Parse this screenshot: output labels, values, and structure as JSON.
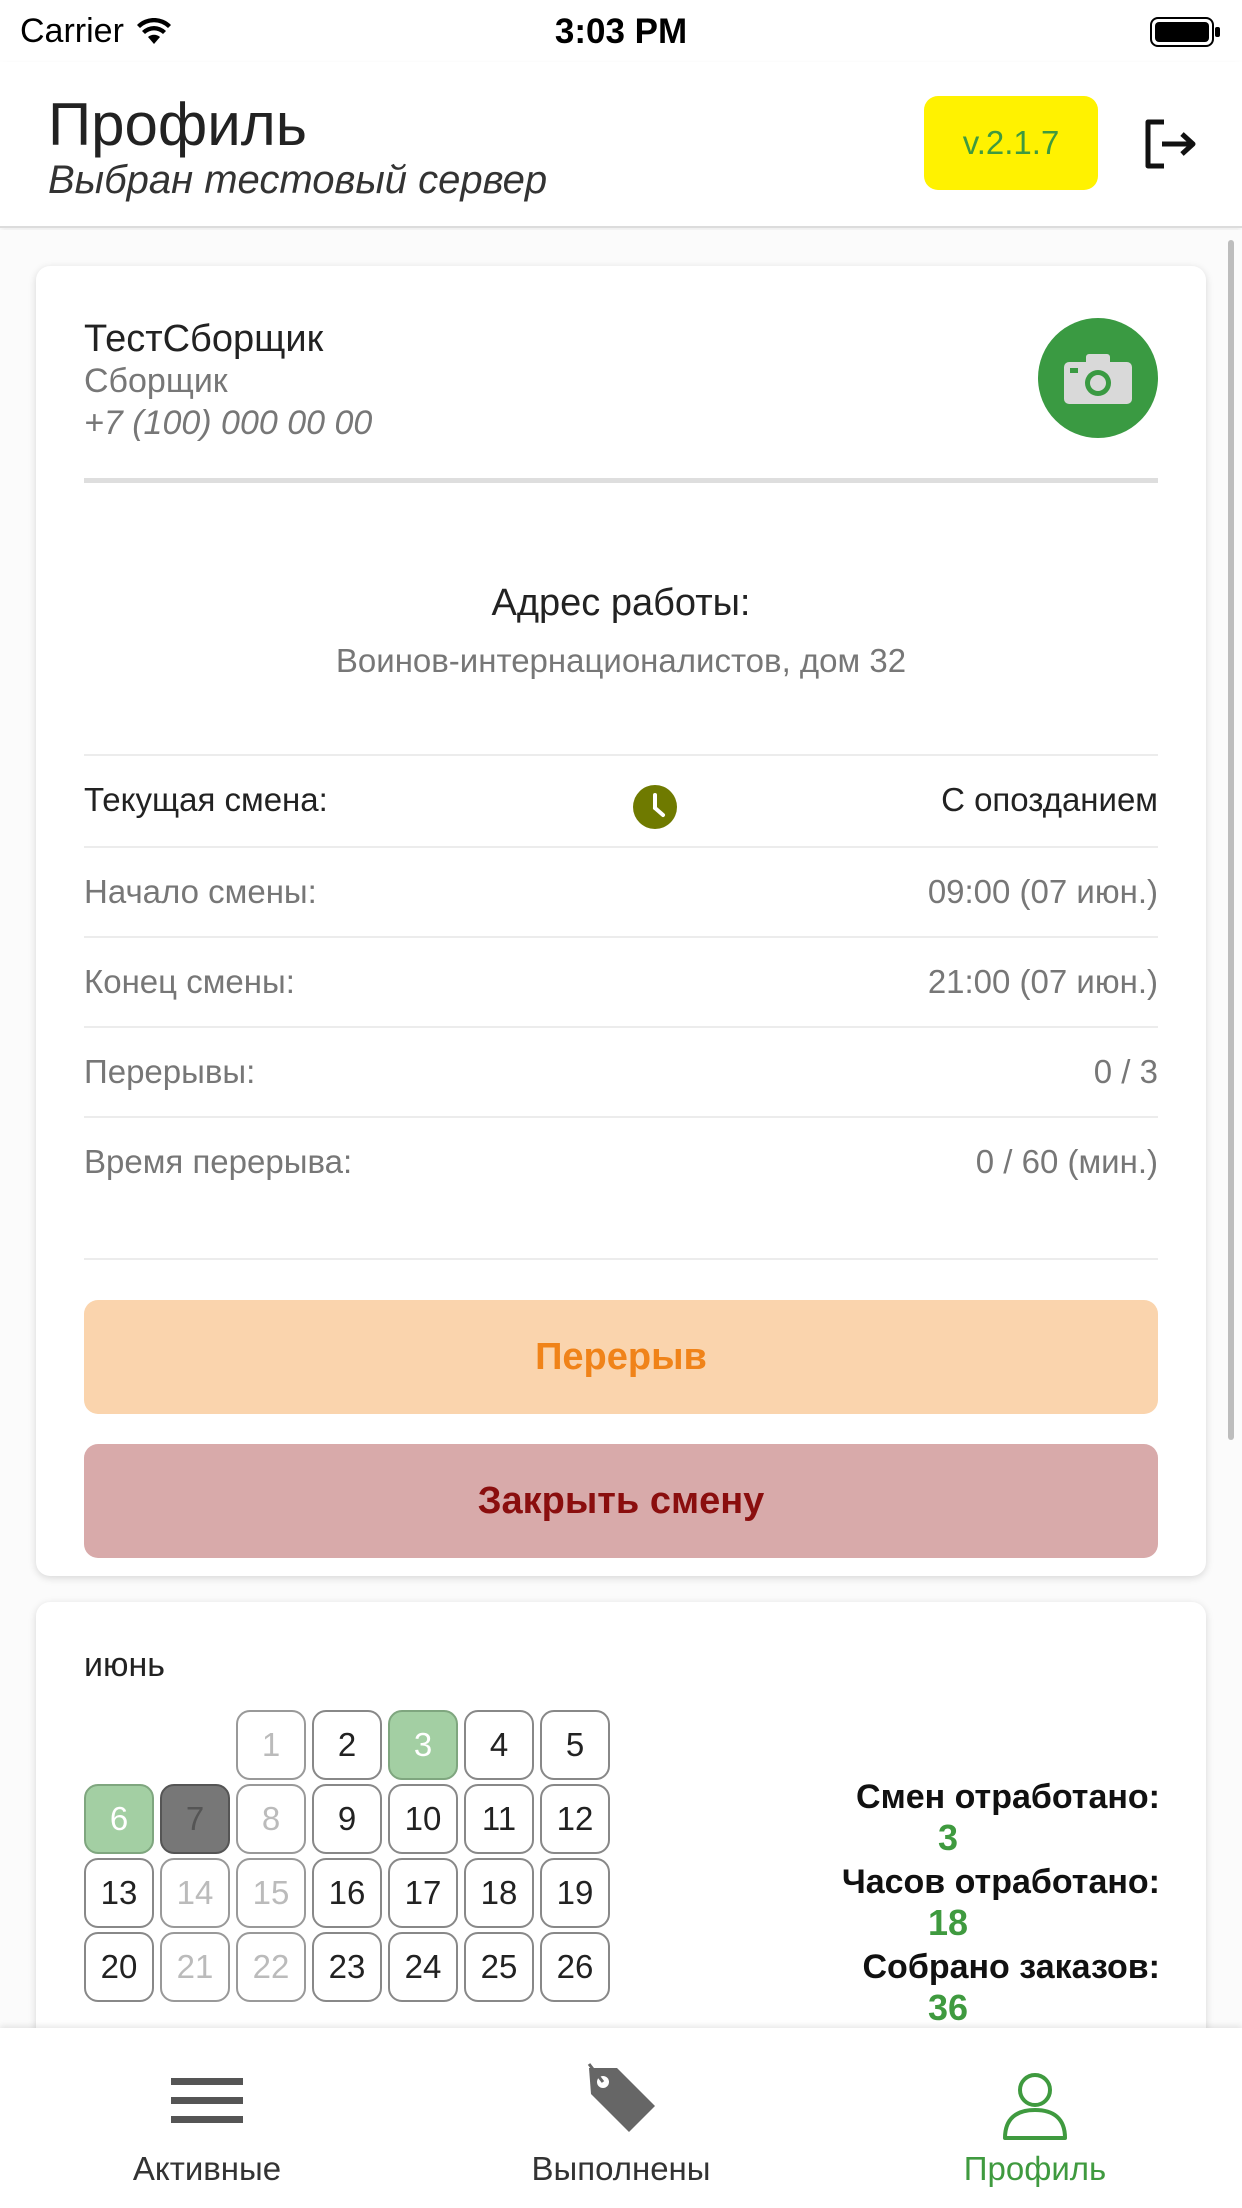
{
  "status_bar": {
    "carrier": "Carrier",
    "time": "3:03 PM"
  },
  "header": {
    "title": "Профиль",
    "subtitle": "Выбран тестовый сервер",
    "version": "v.2.1.7",
    "version_color": "#fff200"
  },
  "profile": {
    "name": "ТестСборщик",
    "role": "Сборщик",
    "phone": "+7 (100) 000 00 00"
  },
  "address": {
    "label": "Адрес работы:",
    "value": "Воинов-интернационалистов, дом 32"
  },
  "shift": {
    "current_label": "Текущая смена:",
    "current_status": "С опозданием",
    "rows": [
      {
        "label": "Начало смены:",
        "value": "09:00 (07 июн.)"
      },
      {
        "label": "Конец смены:",
        "value": "21:00 (07 июн.)"
      },
      {
        "label": "Перерывы:",
        "value": "0 / 3"
      },
      {
        "label": "Время перерыва:",
        "value": "0 / 60 (мин.)"
      }
    ]
  },
  "buttons": {
    "break": "Перерыв",
    "close_shift": "Закрыть смену"
  },
  "calendar": {
    "month": "июнь",
    "days": [
      {
        "n": "1",
        "state": "dim"
      },
      {
        "n": "2",
        "state": "normal"
      },
      {
        "n": "3",
        "state": "green"
      },
      {
        "n": "4",
        "state": "normal"
      },
      {
        "n": "5",
        "state": "normal"
      },
      {
        "n": "6",
        "state": "green"
      },
      {
        "n": "7",
        "state": "dark"
      },
      {
        "n": "8",
        "state": "dim"
      },
      {
        "n": "9",
        "state": "normal"
      },
      {
        "n": "10",
        "state": "normal"
      },
      {
        "n": "11",
        "state": "normal"
      },
      {
        "n": "12",
        "state": "normal"
      },
      {
        "n": "13",
        "state": "normal"
      },
      {
        "n": "14",
        "state": "dim"
      },
      {
        "n": "15",
        "state": "dim"
      },
      {
        "n": "16",
        "state": "normal"
      },
      {
        "n": "17",
        "state": "normal"
      },
      {
        "n": "18",
        "state": "normal"
      },
      {
        "n": "19",
        "state": "normal"
      },
      {
        "n": "20",
        "state": "normal"
      },
      {
        "n": "21",
        "state": "dim"
      },
      {
        "n": "22",
        "state": "dim"
      },
      {
        "n": "23",
        "state": "normal"
      },
      {
        "n": "24",
        "state": "normal"
      },
      {
        "n": "25",
        "state": "normal"
      },
      {
        "n": "26",
        "state": "normal"
      }
    ]
  },
  "stats": [
    {
      "label": "Смен отработано:",
      "value": "3"
    },
    {
      "label": "Часов отработано:",
      "value": "18"
    },
    {
      "label": "Собрано заказов:",
      "value": "36"
    }
  ],
  "tabs": [
    {
      "label": "Активные",
      "icon": "menu-icon",
      "active": false
    },
    {
      "label": "Выполнены",
      "icon": "tag-icon",
      "active": false
    },
    {
      "label": "Профиль",
      "icon": "person-icon",
      "active": true
    }
  ],
  "colors": {
    "accent_green": "#3f9a3f",
    "camera_green": "#3a9a42",
    "break_bg": "#fad4ad",
    "break_text": "#f08319",
    "close_bg": "#d8aaaa",
    "close_text": "#8a0e0e",
    "late_clock": "#6f7a00"
  }
}
